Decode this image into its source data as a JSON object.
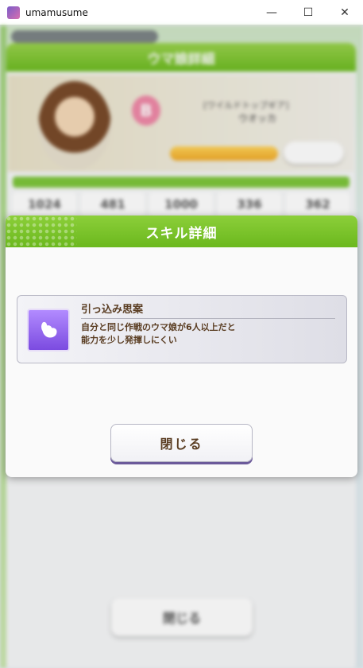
{
  "window": {
    "title": "umamusume",
    "min_label": "—",
    "max_label": "☐",
    "close_label": "✕"
  },
  "background": {
    "header_title": "ウマ娘詳細",
    "rank": "B",
    "name_line1": "[ワイルドトップギア]",
    "name_line2": "ウオッカ",
    "stats": [
      "1024",
      "481",
      "1000",
      "336",
      "362"
    ],
    "close_label": "閉じる"
  },
  "modal": {
    "title": "スキル詳細",
    "skill": {
      "icon": "strength-arm-icon",
      "name": "引っ込み思案",
      "description": "自分と同じ作戦のウマ娘が6人以上だと\n能力を少し発揮しにくい"
    },
    "close_label": "閉じる"
  },
  "colors": {
    "header_green": "#6bb81d",
    "skill_icon_purple": "#7b4be0",
    "text_brown": "#5a3d22"
  }
}
